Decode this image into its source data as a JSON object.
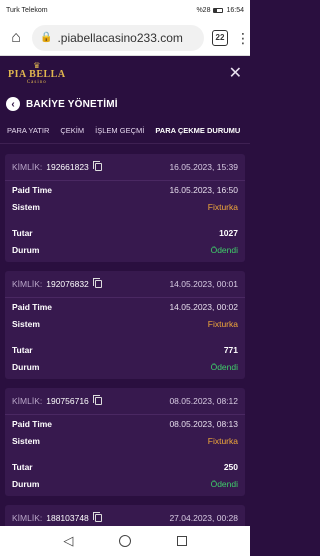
{
  "status_bar": {
    "carrier": "Turk Telekom",
    "battery": "%28",
    "time": "16:54"
  },
  "browser": {
    "url": ".piabellacasino233.com",
    "tab_count": "22"
  },
  "app": {
    "logo_main": "PIA BELLA",
    "logo_sub": "Casino",
    "page_title": "BAKİYE YÖNETİMİ"
  },
  "tabs": [
    {
      "label": "PARA YATIR"
    },
    {
      "label": "ÇEKİM"
    },
    {
      "label": "İŞLEM GEÇMİ"
    },
    {
      "label": "PARA ÇEKME DURUMU"
    }
  ],
  "labels": {
    "kimlik": "KİMLİK:",
    "paid_time": "Paid Time",
    "sistem": "Sistem",
    "tutar": "Tutar",
    "durum": "Durum"
  },
  "transactions": [
    {
      "id": "192661823",
      "created": "16.05.2023, 15:39",
      "paid_time": "16.05.2023, 16:50",
      "sistem": "Fixturka",
      "tutar": "1027",
      "durum": "Ödendi"
    },
    {
      "id": "192076832",
      "created": "14.05.2023, 00:01",
      "paid_time": "14.05.2023, 00:02",
      "sistem": "Fixturka",
      "tutar": "771",
      "durum": "Ödendi"
    },
    {
      "id": "190756716",
      "created": "08.05.2023, 08:12",
      "paid_time": "08.05.2023, 08:13",
      "sistem": "Fixturka",
      "tutar": "250",
      "durum": "Ödendi"
    },
    {
      "id": "188103748",
      "created": "27.04.2023, 00:28"
    }
  ],
  "colors": {
    "background": "#2a0f3f",
    "card": "#37194e",
    "sistem": "#f1a93a",
    "durum_paid": "#3fcf6a"
  }
}
